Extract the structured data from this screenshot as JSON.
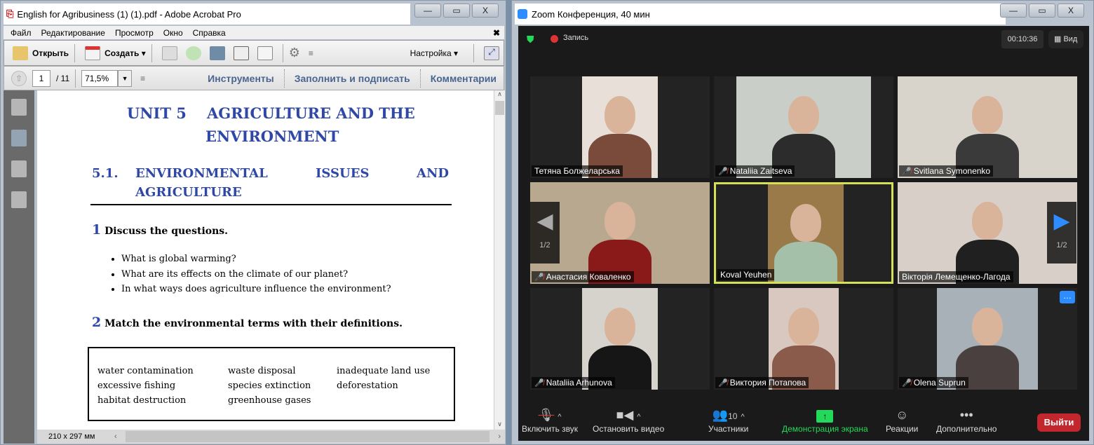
{
  "acrobat": {
    "title": "English for Agribusiness (1) (1).pdf - Adobe Acrobat Pro",
    "menu": [
      "Файл",
      "Редактирование",
      "Просмотр",
      "Окно",
      "Справка"
    ],
    "toolbar": {
      "open": "Открыть",
      "create": "Создать",
      "customize": "Настройка"
    },
    "nav": {
      "page": "1",
      "total": "/ 11",
      "zoom": "71,5%",
      "tools": "Инструменты",
      "fill_sign": "Заполнить и подписать",
      "comments": "Комментарии"
    },
    "status": "210 x 297 мм",
    "document": {
      "unit_title_1": "UNIT 5",
      "unit_title_2": "AGRICULTURE AND THE",
      "unit_title_3": "ENVIRONMENT",
      "section_number": "5.1.",
      "section_title_1": "ENVIRONMENTAL",
      "section_title_2": "ISSUES",
      "section_title_3": "AND",
      "section_title_4": "AGRICULTURE",
      "ex1_num": "1",
      "ex1_text": "Discuss the questions.",
      "questions": [
        "What is global warming?",
        "What are its effects on the climate of our planet?",
        "In what ways does agriculture influence the environment?"
      ],
      "ex2_num": "2",
      "ex2_text": "Match the environmental terms with their definitions.",
      "terms": [
        [
          "water contamination",
          "waste disposal",
          "inadequate land use"
        ],
        [
          "excessive fishing",
          "species extinction",
          "deforestation"
        ],
        [
          "habitat destruction",
          "greenhouse gases",
          ""
        ]
      ]
    }
  },
  "zoom": {
    "title": "Zoom Конференция, 40 мин",
    "recording": "Запись",
    "timer": "00:10:36",
    "view": "Вид",
    "page_indicator": "1/2",
    "participants": [
      {
        "name": "Тетяна Болжеларська",
        "muted": false
      },
      {
        "name": "Nataliia Zaitseva",
        "muted": true
      },
      {
        "name": "Svitlana Symonenko",
        "muted": true
      },
      {
        "name": "Анастасия Коваленко",
        "muted": true
      },
      {
        "name": "Koval Yeuhen",
        "muted": false
      },
      {
        "name": "Вікторія Лемещенко-Лагода",
        "muted": false
      },
      {
        "name": "Nataliia Arhunova",
        "muted": true
      },
      {
        "name": "Виктория Потапова",
        "muted": true
      },
      {
        "name": "Olena Suprun",
        "muted": true
      }
    ],
    "controls": {
      "unmute": "Включить звук",
      "stop_video": "Остановить видео",
      "participants": "Участники",
      "participants_count": "10",
      "share": "Демонстрация экрана",
      "reactions": "Реакции",
      "more": "Дополнительно",
      "leave": "Выйти"
    },
    "colors": {
      "share": "#23d959",
      "leave": "#c1272d",
      "active": "#d4e157"
    }
  }
}
